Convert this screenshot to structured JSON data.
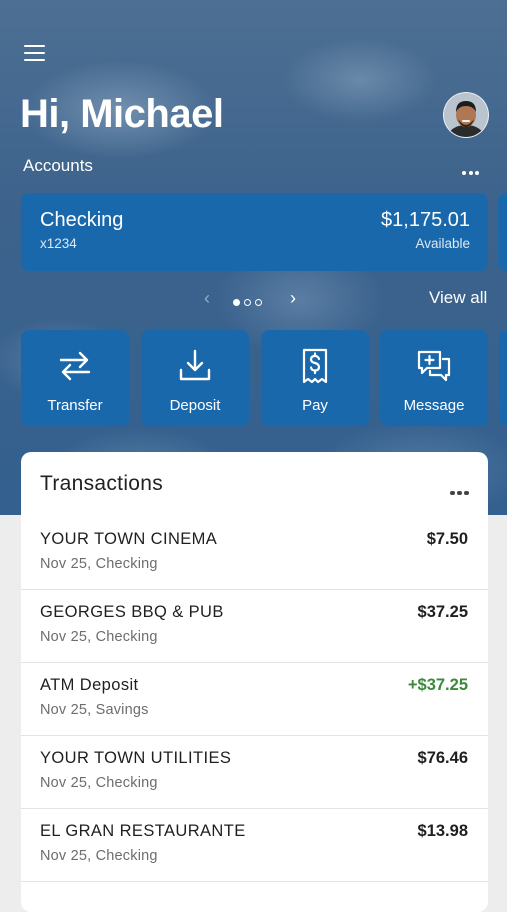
{
  "header": {
    "greeting": "Hi, Michael",
    "accounts_label": "Accounts"
  },
  "account_card": {
    "name": "Checking",
    "number": "x1234",
    "balance": "$1,175.01",
    "balance_label": "Available"
  },
  "pager": {
    "page_count": 3,
    "active_page": 1,
    "view_all_label": "View all"
  },
  "actions": [
    {
      "label": "Transfer",
      "icon": "transfer-icon"
    },
    {
      "label": "Deposit",
      "icon": "deposit-icon"
    },
    {
      "label": "Pay",
      "icon": "pay-bill-icon"
    },
    {
      "label": "Message",
      "icon": "message-icon"
    }
  ],
  "transactions": {
    "title": "Transactions",
    "items": [
      {
        "name": "YOUR TOWN CINEMA",
        "detail": "Nov 25, Checking",
        "amount": "$7.50",
        "credit": false
      },
      {
        "name": "GEORGES BBQ & PUB",
        "detail": "Nov 25, Checking",
        "amount": "$37.25",
        "credit": false
      },
      {
        "name": "ATM Deposit",
        "detail": "Nov 25, Savings",
        "amount": "+$37.25",
        "credit": true
      },
      {
        "name": "YOUR TOWN UTILITIES",
        "detail": "Nov 25, Checking",
        "amount": "$76.46",
        "credit": false
      },
      {
        "name": "EL GRAN RESTAURANTE",
        "detail": "Nov 25, Checking",
        "amount": "$13.98",
        "credit": false
      }
    ]
  },
  "colors": {
    "brand_blue": "#1a68ac",
    "credit_green": "#3a8a3a"
  }
}
